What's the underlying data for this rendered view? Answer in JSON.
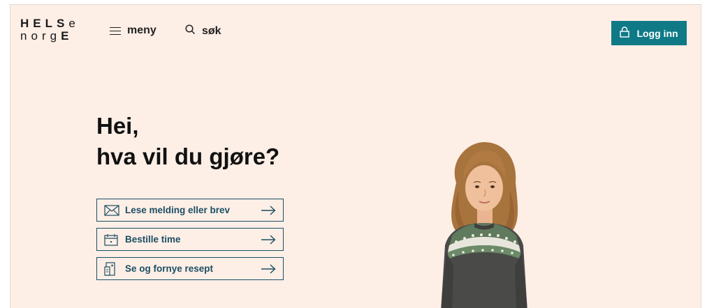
{
  "logo": {
    "line1": [
      "H",
      "E",
      "L",
      "S",
      "e"
    ],
    "line2": [
      "n",
      "o",
      "r",
      "g",
      "E"
    ]
  },
  "nav": {
    "menu_label": "meny",
    "search_label": "søk"
  },
  "login": {
    "label": "Logg inn"
  },
  "hero": {
    "greeting": "Hei,",
    "question": "hva vil du gjøre?"
  },
  "actions": [
    {
      "label": "Lese melding eller brev",
      "icon": "envelope-icon"
    },
    {
      "label": "Bestille time",
      "icon": "calendar-icon"
    },
    {
      "label": "Se og fornye resept",
      "icon": "prescription-icon"
    }
  ],
  "colors": {
    "background": "#fdeee6",
    "accent": "#0f7a86",
    "outline": "#1b4f63"
  }
}
